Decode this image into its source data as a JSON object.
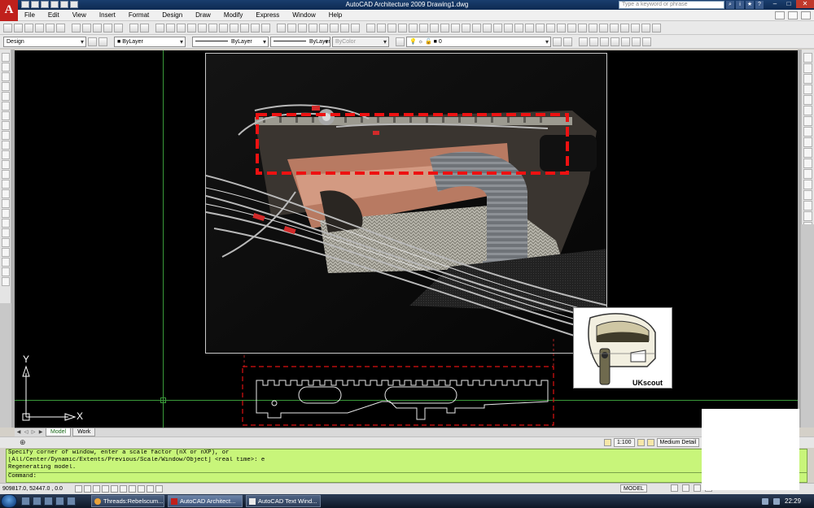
{
  "window": {
    "title": "AutoCAD Architecture 2009  Drawing1.dwg",
    "search_placeholder": "Type a keyword or phrase",
    "logo_letter": "A"
  },
  "menu": [
    "File",
    "Edit",
    "View",
    "Insert",
    "Format",
    "Design",
    "Draw",
    "Modify",
    "Express",
    "Window",
    "Help"
  ],
  "toolbar": {
    "workspace": "Design",
    "color": "ByLayer",
    "linetype": "ByLayer",
    "lineweight": "ByLayer",
    "plotstyle": "ByColor",
    "layer": "0"
  },
  "drawing": {
    "ucs_y": "Y",
    "ucs_x": "X",
    "logo_text": "UKscout"
  },
  "layout_tabs": [
    {
      "label": "Model",
      "active": true
    },
    {
      "label": "Work",
      "active": false
    }
  ],
  "annotation": {
    "scale": "1:100",
    "detail": "Medium Detail"
  },
  "command": {
    "lines": [
      "Specify corner of window, enter a scale factor (nX or nXP), or",
      "[All/Center/Dynamic/Extents/Previous/Scale/Window/Object] <real time>: e",
      "Regenerating model."
    ],
    "prompt": "Command:"
  },
  "status": {
    "coordinates": "909817.0,  52447.0 , 0.0",
    "model": "MODEL"
  },
  "taskbar": {
    "tasks": [
      {
        "label": "Threads:Rebelscum....",
        "active": false
      },
      {
        "label": "AutoCAD Architect...",
        "active": true
      },
      {
        "label": "AutoCAD Text Wind...",
        "active": false
      }
    ],
    "clock": "22:29"
  },
  "colors": {
    "command_bg": "#c8f57a",
    "highlight_dash": "#ee1111",
    "grid_line": "#3a9a3a"
  }
}
